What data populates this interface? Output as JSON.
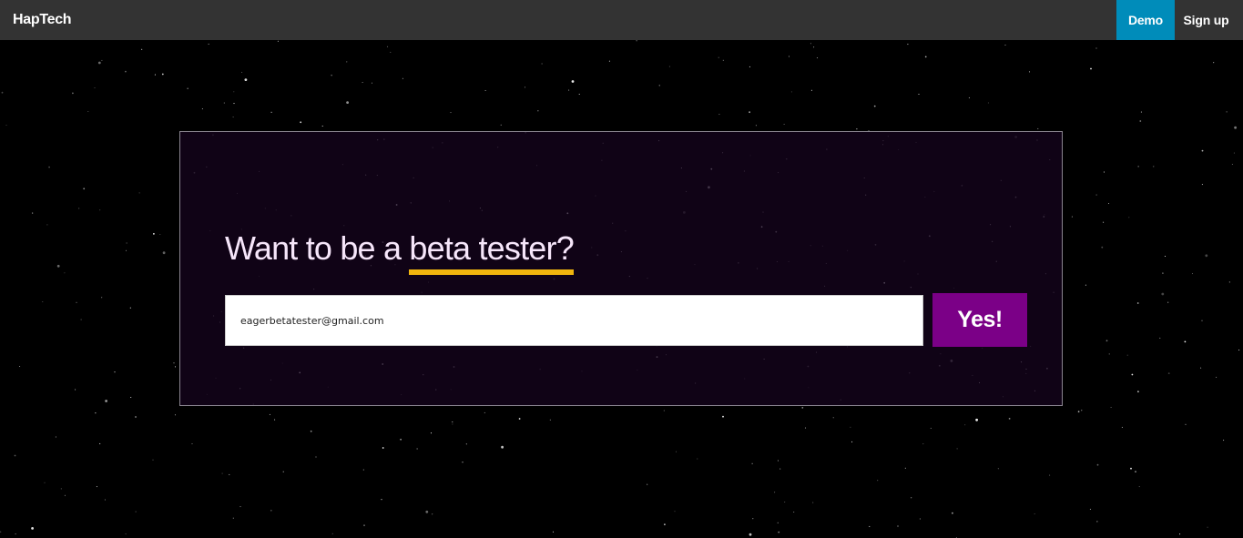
{
  "navbar": {
    "brand": "HapTech",
    "items": [
      {
        "label": "Demo",
        "active": true
      },
      {
        "label": "Sign up",
        "active": false
      }
    ],
    "active_color": "#008cba",
    "background_color": "#333333"
  },
  "signup": {
    "headline_prefix": "Want to be a ",
    "headline_highlight": "beta tester?",
    "highlight_color": "#f0b50e",
    "email_value": "eagerbetatester@gmail.com",
    "submit_label": "Yes!",
    "submit_color": "#7b0087"
  },
  "background": {
    "style": "starfield",
    "color": "#000000"
  }
}
